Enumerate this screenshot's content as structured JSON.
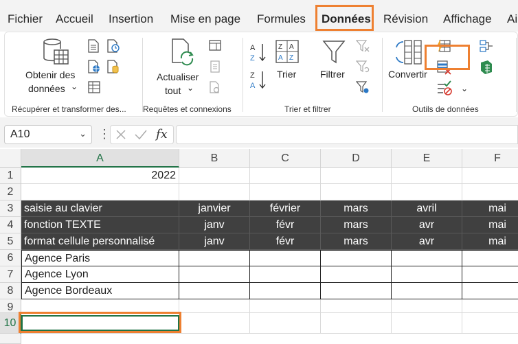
{
  "tabs": [
    {
      "label": "Fichier"
    },
    {
      "label": "Accueil"
    },
    {
      "label": "Insertion"
    },
    {
      "label": "Mise en page"
    },
    {
      "label": "Formules"
    },
    {
      "label": "Données"
    },
    {
      "label": "Révision"
    },
    {
      "label": "Affichage"
    },
    {
      "label": "Ai"
    }
  ],
  "ribbon": {
    "get_data_line1": "Obtenir des",
    "get_data_line2": "données",
    "refresh_line1": "Actualiser",
    "refresh_line2": "tout",
    "sort": "Trier",
    "filter": "Filtrer",
    "convert": "Convertir",
    "chevron": "⌄",
    "groups": {
      "transform": "Récupérer et transformer des...",
      "queries": "Requêtes et connexions",
      "sort_filter": "Trier et filtrer",
      "data_tools": "Outils de données"
    },
    "accent": "#217346",
    "highlight": "#ee8031"
  },
  "formula_bar": {
    "name_box": "A10",
    "fx": "fx",
    "value": ""
  },
  "grid": {
    "columns": [
      "A",
      "B",
      "C",
      "D",
      "E",
      "F"
    ],
    "rows": [
      "1",
      "2",
      "3",
      "4",
      "5",
      "6",
      "7",
      "8",
      "9",
      "10"
    ],
    "cells": {
      "A1": "2022",
      "A3": "saisie au clavier",
      "A4": "fonction TEXTE",
      "A5": "format cellule personnalisé",
      "A6": "Agence Paris",
      "A7": "Agence Lyon",
      "A8": "Agence Bordeaux",
      "B3": "janvier",
      "C3": "février",
      "D3": "mars",
      "E3": "avril",
      "F3": "mai",
      "B4": "janv",
      "C4": "févr",
      "D4": "mars",
      "E4": "avr",
      "F4": "mai",
      "B5": "janv",
      "C5": "févr",
      "D5": "mars",
      "E5": "avr",
      "F5": "mai"
    },
    "selected_cell": "A10"
  }
}
